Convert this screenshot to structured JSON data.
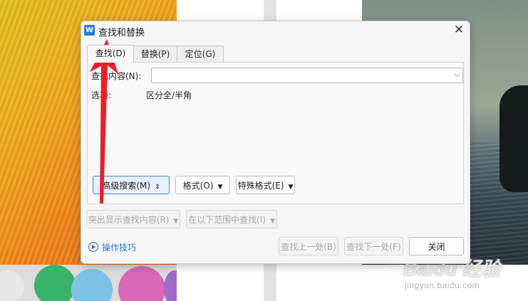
{
  "dialog": {
    "title": "查找和替换",
    "app_icon_letter": "W",
    "close_glyph": "✕"
  },
  "tabs": [
    {
      "label": "查找(D)",
      "active": true
    },
    {
      "label": "替换(P)",
      "active": false
    },
    {
      "label": "定位(G)",
      "active": false
    }
  ],
  "find": {
    "label": "查找内容(N):",
    "value": "",
    "dropdown_glyph": "⌵"
  },
  "options": {
    "label": "选项:",
    "value": "区分全/半角"
  },
  "buttons": {
    "advanced": "高级搜索(M)",
    "format": "格式(O)",
    "special": "特殊格式(E)",
    "highlight": "突出显示查找内容(R)",
    "find_in": "在以下范围中查找(I)",
    "prev": "查找上一处(B)",
    "next": "查找下一处(F)",
    "close": "关闭"
  },
  "link": {
    "label": "操作技巧"
  },
  "watermark": {
    "logo": "Baidu 经验",
    "sub": "jingyan.baidu.com"
  },
  "colors": {
    "accent": "#2b7ad9",
    "arrow": "#e8202a",
    "link": "#2a6fc9"
  }
}
